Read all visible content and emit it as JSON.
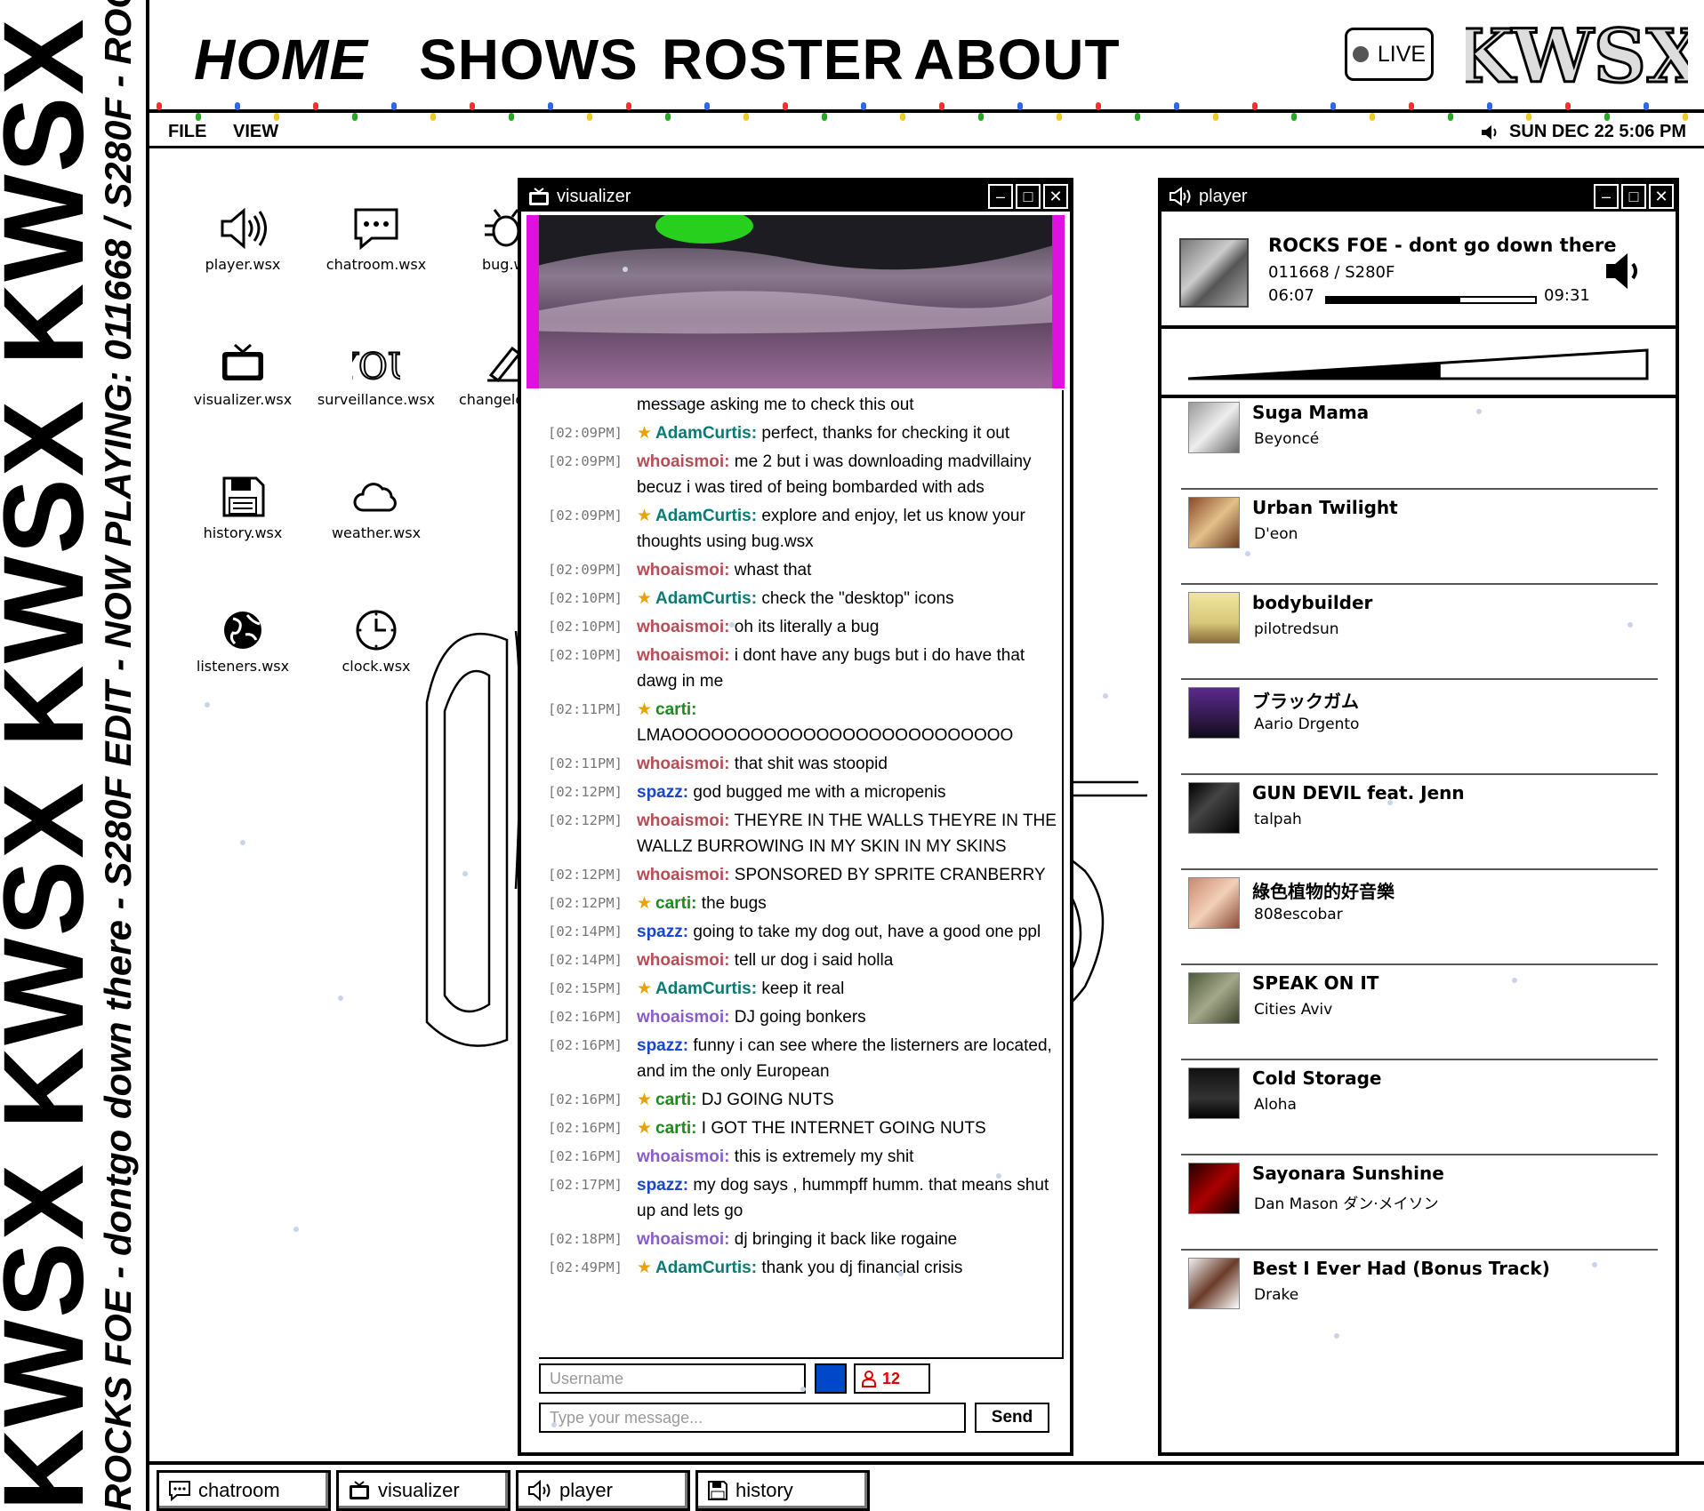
{
  "ticker": {
    "kwsx_repeat": "KWSX KWSX KWSX KWSX KWSX KW",
    "now_playing": "ROCKS FOE - dontgo down there - S280F EDIT - NOW PLAYING: 011668 / S280F - ROC"
  },
  "nav": {
    "home": "HOME",
    "shows": "SHOWS",
    "roster": "ROSTER",
    "about": "ABOUT",
    "live": "LIVE",
    "logo_text": "KWSX"
  },
  "menubar": {
    "file": "FILE",
    "view": "VIEW",
    "datetime": "SUN DEC 22 5:06 PM"
  },
  "desktop_icons": [
    {
      "label": "player.wsx",
      "icon": "speaker-icon"
    },
    {
      "label": "chatroom.wsx",
      "icon": "chat-bubble-icon"
    },
    {
      "label": "bug.wsx",
      "icon": "bug-icon"
    },
    {
      "label": "visualizer.wsx",
      "icon": "tv-icon"
    },
    {
      "label": "surveillance.wsx",
      "icon": "you-icon"
    },
    {
      "label": "changelog.wsx",
      "icon": "pen-icon"
    },
    {
      "label": "history.wsx",
      "icon": "floppy-icon"
    },
    {
      "label": "weather.wsx",
      "icon": "cloud-icon"
    },
    {
      "label": "listeners.wsx",
      "icon": "globe-icon"
    },
    {
      "label": "clock.wsx",
      "icon": "clock-icon"
    }
  ],
  "visualizer": {
    "title": "visualizer"
  },
  "chat": {
    "partial_top": "message asking me to check this out",
    "messages": [
      {
        "ts": "[02:09PM]",
        "user": "AdamCurtis:",
        "star": true,
        "color": "adam",
        "text": "perfect, thanks for checking it out"
      },
      {
        "ts": "[02:09PM]",
        "user": "whoaismoi:",
        "star": false,
        "color": "whoai",
        "text": "me 2 but i was downloading madvillainy becuz i was tired of being bombarded with ads"
      },
      {
        "ts": "[02:09PM]",
        "user": "AdamCurtis:",
        "star": true,
        "color": "adam",
        "text": "explore and enjoy, let us know your thoughts using bug.wsx"
      },
      {
        "ts": "[02:09PM]",
        "user": "whoaismoi:",
        "star": false,
        "color": "whoai",
        "text": "whast that"
      },
      {
        "ts": "[02:10PM]",
        "user": "AdamCurtis:",
        "star": true,
        "color": "adam",
        "text": "check the \"desktop\" icons"
      },
      {
        "ts": "[02:10PM]",
        "user": "whoaismoi:",
        "star": false,
        "color": "whoai",
        "text": "oh its literally a bug"
      },
      {
        "ts": "[02:10PM]",
        "user": "whoaismoi:",
        "star": false,
        "color": "whoai",
        "text": "i dont have any bugs but i do have that dawg in me"
      },
      {
        "ts": "[02:11PM]",
        "user": "carti:",
        "star": true,
        "color": "carti",
        "text": "LMAOOOOOOOOOOOOOOOOOOOOOOOOOO"
      },
      {
        "ts": "[02:11PM]",
        "user": "whoaismoi:",
        "star": false,
        "color": "whoai",
        "text": "that shit was stoopid"
      },
      {
        "ts": "[02:12PM]",
        "user": "spazz:",
        "star": false,
        "color": "spazz",
        "text": "god bugged me with a micropenis"
      },
      {
        "ts": "[02:12PM]",
        "user": "whoaismoi:",
        "star": false,
        "color": "whoai",
        "text": "THEYRE IN THE WALLS THEYRE IN THE WALLZ BURROWING IN MY SKIN IN MY SKINS"
      },
      {
        "ts": "[02:12PM]",
        "user": "whoaismoi:",
        "star": false,
        "color": "whoai",
        "text": "SPONSORED BY SPRITE CRANBERRY"
      },
      {
        "ts": "[02:12PM]",
        "user": "carti:",
        "star": true,
        "color": "carti",
        "text": "the bugs"
      },
      {
        "ts": "[02:14PM]",
        "user": "spazz:",
        "star": false,
        "color": "spazz",
        "text": "going to take my dog out, have a good one ppl"
      },
      {
        "ts": "[02:14PM]",
        "user": "whoaismoi:",
        "star": false,
        "color": "whoai",
        "text": "tell ur dog i said holla"
      },
      {
        "ts": "[02:15PM]",
        "user": "AdamCurtis:",
        "star": true,
        "color": "adam",
        "text": "keep it real"
      },
      {
        "ts": "[02:16PM]",
        "user": "whoaismoi:",
        "star": false,
        "color": "whoai2",
        "text": "DJ going bonkers"
      },
      {
        "ts": "[02:16PM]",
        "user": "spazz:",
        "star": false,
        "color": "spazz",
        "text": "funny i can see where the listerners are located, and im the only European"
      },
      {
        "ts": "[02:16PM]",
        "user": "carti:",
        "star": true,
        "color": "carti",
        "text": "DJ GOING NUTS"
      },
      {
        "ts": "[02:16PM]",
        "user": "carti:",
        "star": true,
        "color": "carti",
        "text": "I GOT THE INTERNET GOING NUTS"
      },
      {
        "ts": "[02:16PM]",
        "user": "whoaismoi:",
        "star": false,
        "color": "whoai2",
        "text": "this is extremely my shit"
      },
      {
        "ts": "[02:17PM]",
        "user": "spazz:",
        "star": false,
        "color": "spazz",
        "text": "my dog says , hummpff humm. that means shut up and lets go"
      },
      {
        "ts": "[02:18PM]",
        "user": "whoaismoi:",
        "star": false,
        "color": "whoai2",
        "text": "dj bringing it back like rogaine"
      },
      {
        "ts": "[02:49PM]",
        "user": "AdamCurtis:",
        "star": true,
        "color": "adam",
        "text": "thank you dj financial crisis"
      }
    ],
    "username_placeholder": "Username",
    "message_placeholder": "Type your message...",
    "user_count": "12",
    "send_label": "Send",
    "swatch_color": "#0047c9"
  },
  "player": {
    "title": "player",
    "now_playing": {
      "title": "ROCKS FOE - dont go down there",
      "id": "011668 / S280F",
      "current": "06:07",
      "total": "09:31",
      "progress": 0.64
    },
    "volume": 0.55,
    "playlist": [
      {
        "title": "Suga Mama",
        "artist": "Beyoncé"
      },
      {
        "title": "Urban Twilight",
        "artist": "D'eon"
      },
      {
        "title": "bodybuilder",
        "artist": "pilotredsun"
      },
      {
        "title": "ブラックガム",
        "artist": "Aario Drgento"
      },
      {
        "title": "GUN DEVIL feat. Jenn",
        "artist": "talpah"
      },
      {
        "title": "綠色植物的好音樂",
        "artist": "808escobar"
      },
      {
        "title": "SPEAK ON IT",
        "artist": "Cities Aviv"
      },
      {
        "title": "Cold Storage",
        "artist": "Aloha"
      },
      {
        "title": "Sayonara Sunshine",
        "artist": "Dan Mason ダン·メイソン"
      },
      {
        "title": "Best I Ever Had (Bonus Track)",
        "artist": "Drake"
      }
    ]
  },
  "taskbar": [
    {
      "label": "chatroom",
      "icon": "chat-bubble-icon"
    },
    {
      "label": "visualizer",
      "icon": "tv-icon"
    },
    {
      "label": "player",
      "icon": "speaker-icon"
    },
    {
      "label": "history",
      "icon": "floppy-icon"
    }
  ]
}
